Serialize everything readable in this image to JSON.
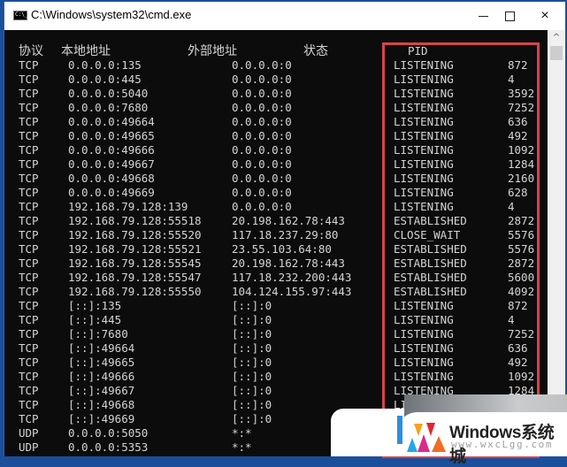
{
  "window": {
    "title": "C:\\Windows\\system32\\cmd.exe",
    "icon": "cmd-icon",
    "icon_text": "C:\\_",
    "controls": {
      "minimize": "minimize",
      "maximize": "maximize",
      "close": "×"
    }
  },
  "console": {
    "headers": {
      "proto": "协议",
      "local": "本地地址",
      "foreign": "外部地址",
      "state": "状态",
      "pid": "PID"
    },
    "rows": [
      {
        "proto": "TCP",
        "local": "0.0.0.0:135",
        "foreign": "0.0.0.0:0",
        "state": "LISTENING",
        "pid": "872"
      },
      {
        "proto": "TCP",
        "local": "0.0.0.0:445",
        "foreign": "0.0.0.0:0",
        "state": "LISTENING",
        "pid": "4"
      },
      {
        "proto": "TCP",
        "local": "0.0.0.0:5040",
        "foreign": "0.0.0.0:0",
        "state": "LISTENING",
        "pid": "3592"
      },
      {
        "proto": "TCP",
        "local": "0.0.0.0:7680",
        "foreign": "0.0.0.0:0",
        "state": "LISTENING",
        "pid": "7252"
      },
      {
        "proto": "TCP",
        "local": "0.0.0.0:49664",
        "foreign": "0.0.0.0:0",
        "state": "LISTENING",
        "pid": "636"
      },
      {
        "proto": "TCP",
        "local": "0.0.0.0:49665",
        "foreign": "0.0.0.0:0",
        "state": "LISTENING",
        "pid": "492"
      },
      {
        "proto": "TCP",
        "local": "0.0.0.0:49666",
        "foreign": "0.0.0.0:0",
        "state": "LISTENING",
        "pid": "1092"
      },
      {
        "proto": "TCP",
        "local": "0.0.0.0:49667",
        "foreign": "0.0.0.0:0",
        "state": "LISTENING",
        "pid": "1284"
      },
      {
        "proto": "TCP",
        "local": "0.0.0.0:49668",
        "foreign": "0.0.0.0:0",
        "state": "LISTENING",
        "pid": "2160"
      },
      {
        "proto": "TCP",
        "local": "0.0.0.0:49669",
        "foreign": "0.0.0.0:0",
        "state": "LISTENING",
        "pid": "628"
      },
      {
        "proto": "TCP",
        "local": "192.168.79.128:139",
        "foreign": "0.0.0.0:0",
        "state": "LISTENING",
        "pid": "4"
      },
      {
        "proto": "TCP",
        "local": "192.168.79.128:55518",
        "foreign": "20.198.162.78:443",
        "state": "ESTABLISHED",
        "pid": "2872"
      },
      {
        "proto": "TCP",
        "local": "192.168.79.128:55520",
        "foreign": "117.18.237.29:80",
        "state": "CLOSE_WAIT",
        "pid": "5576"
      },
      {
        "proto": "TCP",
        "local": "192.168.79.128:55521",
        "foreign": "23.55.103.64:80",
        "state": "ESTABLISHED",
        "pid": "5576"
      },
      {
        "proto": "TCP",
        "local": "192.168.79.128:55545",
        "foreign": "20.198.162.78:443",
        "state": "ESTABLISHED",
        "pid": "2872"
      },
      {
        "proto": "TCP",
        "local": "192.168.79.128:55547",
        "foreign": "117.18.232.200:443",
        "state": "ESTABLISHED",
        "pid": "5600"
      },
      {
        "proto": "TCP",
        "local": "192.168.79.128:55550",
        "foreign": "104.124.155.97:443",
        "state": "ESTABLISHED",
        "pid": "4092"
      },
      {
        "proto": "TCP",
        "local": "[::]:135",
        "foreign": "[::]:0",
        "state": "LISTENING",
        "pid": "872"
      },
      {
        "proto": "TCP",
        "local": "[::]:445",
        "foreign": "[::]:0",
        "state": "LISTENING",
        "pid": "4"
      },
      {
        "proto": "TCP",
        "local": "[::]:7680",
        "foreign": "[::]:0",
        "state": "LISTENING",
        "pid": "7252"
      },
      {
        "proto": "TCP",
        "local": "[::]:49664",
        "foreign": "[::]:0",
        "state": "LISTENING",
        "pid": "636"
      },
      {
        "proto": "TCP",
        "local": "[::]:49665",
        "foreign": "[::]:0",
        "state": "LISTENING",
        "pid": "492"
      },
      {
        "proto": "TCP",
        "local": "[::]:49666",
        "foreign": "[::]:0",
        "state": "LISTENING",
        "pid": "1092"
      },
      {
        "proto": "TCP",
        "local": "[::]:49667",
        "foreign": "[::]:0",
        "state": "LISTENING",
        "pid": "1284"
      },
      {
        "proto": "TCP",
        "local": "[::]:49668",
        "foreign": "[::]:0",
        "state": "LISTENING",
        "pid": ""
      },
      {
        "proto": "TCP",
        "local": "[::]:49669",
        "foreign": "[::]:0",
        "state": "",
        "pid": ""
      },
      {
        "proto": "UDP",
        "local": "0.0.0.0:5050",
        "foreign": "*:*",
        "state": "",
        "pid": ""
      },
      {
        "proto": "UDP",
        "local": "0.0.0.0:5353",
        "foreign": "*:*",
        "state": "",
        "pid": ""
      }
    ]
  },
  "highlight": {
    "label": "PID column highlight",
    "color": "#d9434a"
  },
  "scrollbar": {
    "up_arrow": "^"
  },
  "watermark": {
    "title": "Windows系统城",
    "url": "www.wxcLgg.com"
  }
}
